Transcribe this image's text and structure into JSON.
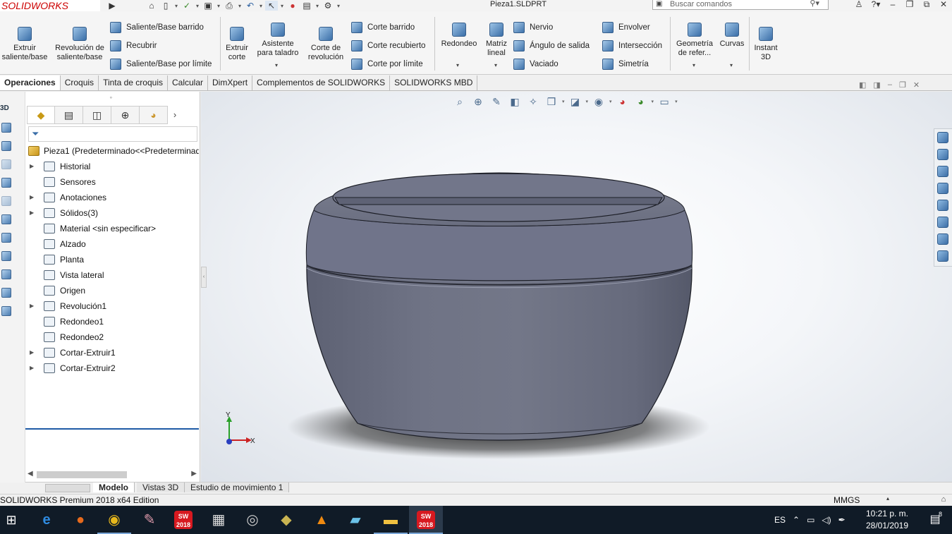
{
  "app": {
    "logo_text": "SOLIDWORKS",
    "document_title": "Pieza1.SLDPRT",
    "search_placeholder": "Buscar comandos",
    "brand_color": "#d22020"
  },
  "ribbon": {
    "big_buttons": [
      {
        "label": "Extruir saliente/base",
        "icon": "extrude-boss-icon"
      },
      {
        "label": "Revolución de saliente/base",
        "icon": "revolve-boss-icon"
      },
      {
        "label": "Extruir corte",
        "icon": "extrude-cut-icon"
      },
      {
        "label": "Asistente para taladro",
        "icon": "hole-wizard-icon"
      },
      {
        "label": "Corte de revolución",
        "icon": "revolve-cut-icon"
      },
      {
        "label": "Redondeo",
        "icon": "fillet-icon"
      },
      {
        "label": "Matriz lineal",
        "icon": "linear-pattern-icon"
      },
      {
        "label": "Geometría de refer...",
        "icon": "reference-geometry-icon"
      },
      {
        "label": "Curvas",
        "icon": "curves-icon"
      },
      {
        "label": "Instant 3D",
        "icon": "instant3d-icon"
      }
    ],
    "small_group1": [
      {
        "label": "Saliente/Base barrido",
        "icon": "swept-boss-icon"
      },
      {
        "label": "Recubrir",
        "icon": "loft-icon"
      },
      {
        "label": "Saliente/Base por límite",
        "icon": "boundary-boss-icon"
      }
    ],
    "small_group2": [
      {
        "label": "Corte barrido",
        "icon": "swept-cut-icon"
      },
      {
        "label": "Corte recubierto",
        "icon": "lofted-cut-icon"
      },
      {
        "label": "Corte por límite",
        "icon": "boundary-cut-icon"
      }
    ],
    "small_group3": [
      {
        "label": "Nervio",
        "icon": "rib-icon"
      },
      {
        "label": "Ángulo de salida",
        "icon": "draft-icon"
      },
      {
        "label": "Vaciado",
        "icon": "shell-icon"
      }
    ],
    "small_group4": [
      {
        "label": "Envolver",
        "icon": "wrap-icon"
      },
      {
        "label": "Intersección",
        "icon": "intersect-icon"
      },
      {
        "label": "Simetría",
        "icon": "mirror-icon"
      }
    ]
  },
  "command_tabs": [
    "Operaciones",
    "Croquis",
    "Tinta de croquis",
    "Calcular",
    "DimXpert",
    "Complementos de SOLIDWORKS",
    "SOLIDWORKS MBD"
  ],
  "feature_tree": {
    "root": "Pieza1  (Predeterminado<<Predeterminad",
    "items": [
      {
        "label": "Historial",
        "expandable": true,
        "icon": "history-folder-icon"
      },
      {
        "label": "Sensores",
        "expandable": false,
        "icon": "sensor-icon"
      },
      {
        "label": "Anotaciones",
        "expandable": true,
        "icon": "annotations-icon"
      },
      {
        "label": "Sólidos(3)",
        "expandable": true,
        "icon": "solid-bodies-icon"
      },
      {
        "label": "Material <sin especificar>",
        "expandable": false,
        "icon": "material-icon"
      },
      {
        "label": "Alzado",
        "expandable": false,
        "icon": "plane-icon"
      },
      {
        "label": "Planta",
        "expandable": false,
        "icon": "plane-icon"
      },
      {
        "label": "Vista lateral",
        "expandable": false,
        "icon": "plane-icon"
      },
      {
        "label": "Origen",
        "expandable": false,
        "icon": "origin-icon"
      },
      {
        "label": "Revolución1",
        "expandable": true,
        "icon": "revolve-feature-icon"
      },
      {
        "label": "Redondeo1",
        "expandable": false,
        "icon": "fillet-feature-icon"
      },
      {
        "label": "Redondeo2",
        "expandable": false,
        "icon": "fillet-feature-icon"
      },
      {
        "label": "Cortar-Extruir1",
        "expandable": true,
        "icon": "cut-extrude-feature-icon"
      },
      {
        "label": "Cortar-Extruir2",
        "expandable": true,
        "icon": "cut-extrude-feature-icon"
      }
    ]
  },
  "triad": {
    "y": "Y",
    "x": "X"
  },
  "model_tabs": [
    "Modelo",
    "Vistas 3D",
    "Estudio de movimiento 1"
  ],
  "status": {
    "edition": "SOLIDWORKS Premium 2018 x64 Edition",
    "units": "MMGS"
  },
  "taskbar": {
    "language": "ES",
    "time": "10:21 p. m.",
    "date": "28/01/2019",
    "notification_count": "8",
    "sw_badge": "SW 2018"
  },
  "left_strip": {
    "label_3d": "3D"
  },
  "colors": {
    "model_gray": "#6b6f80",
    "taskbar": "#101b27",
    "selection_blue": "#1e5aa6"
  }
}
